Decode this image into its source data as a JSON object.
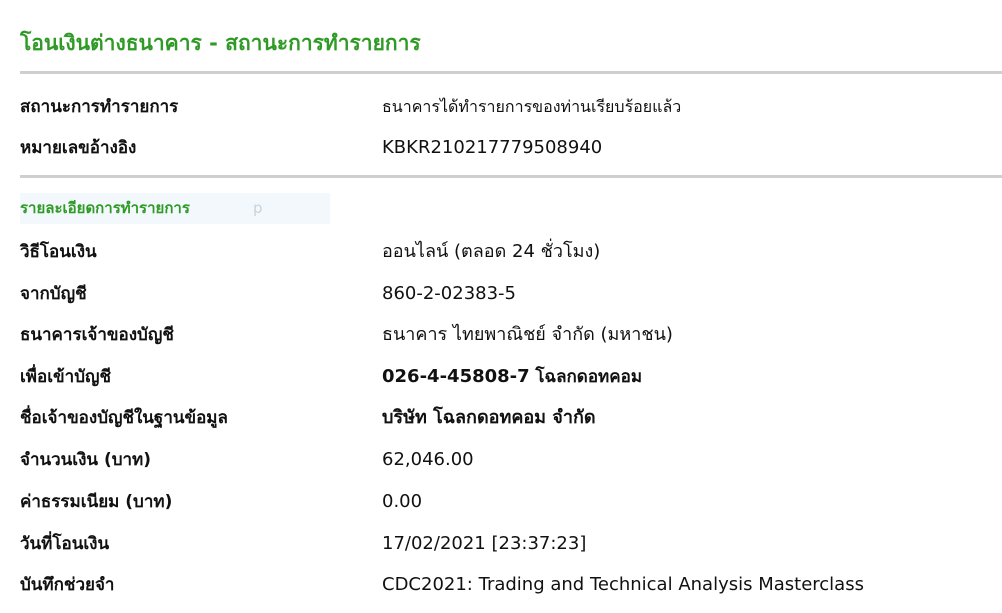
{
  "header": {
    "title": "โอนเงินต่างธนาคาร - สถานะการทำรายการ"
  },
  "summary": [
    {
      "label": "สถานะการทำรายการ",
      "value": "ธนาคารได้ทำรายการของท่านเรียบร้อยแล้ว"
    },
    {
      "label": "หมายเลขอ้างอิง",
      "value": "KBKR210217779508940"
    }
  ],
  "details": {
    "section_title": "รายละเอียดการทำรายการ",
    "ghost_char": "p",
    "rows": [
      {
        "label": "วิธีโอนเงิน",
        "value": "ออนไลน์ (ตลอด 24 ชั่วโมง)"
      },
      {
        "label": "จากบัญชี",
        "value": "860-2-02383-5"
      },
      {
        "label": "ธนาคารเจ้าของบัญชี",
        "value": "ธนาคาร ไทยพาณิชย์ จำกัด (มหาชน)"
      },
      {
        "label": "เพื่อเข้าบัญชี",
        "value": "026-4-45808-7",
        "value_suffix": "โฉลกดอทคอม"
      },
      {
        "label": "ชื่อเจ้าของบัญชีในฐานข้อมูล",
        "value": "บริษัท โฉลกดอทคอม จำกัด"
      },
      {
        "label": "จำนวนเงิน (บาท)",
        "value": "62,046.00"
      },
      {
        "label": "ค่าธรรมเนียม (บาท)",
        "value": "0.00"
      },
      {
        "label": "วันที่โอนเงิน",
        "value": "17/02/2021 [23:37:23]"
      },
      {
        "label": "บันทึกช่วยจำ",
        "value": "CDC2021: Trading and Technical Analysis Masterclass"
      }
    ]
  },
  "colors": {
    "accent_green": "#2f9a25",
    "divider": "#cfcfcf",
    "section_bg": "#f2f8fc"
  }
}
